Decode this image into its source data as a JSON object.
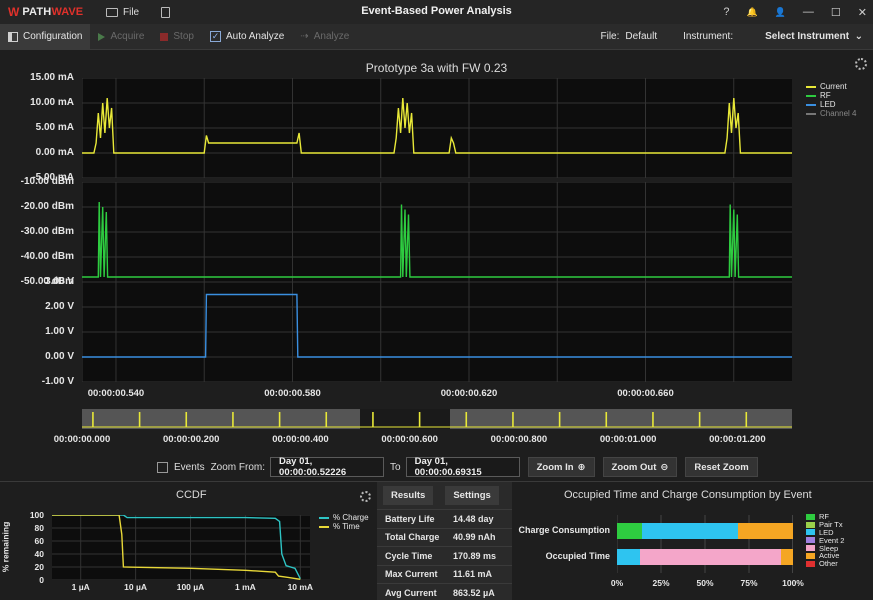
{
  "app": {
    "logo_mark": "W",
    "logo_text_a": "PATH",
    "logo_text_b": "WAVE",
    "title": "Event-Based Power Analysis",
    "file_menu": "File",
    "window_controls": [
      "?",
      "🔔",
      "👤",
      "—",
      "☐",
      "✕"
    ]
  },
  "toolbar": {
    "configuration": "Configuration",
    "acquire": "Acquire",
    "stop": "Stop",
    "auto_analyze": "Auto Analyze",
    "auto_analyze_checked": true,
    "analyze": "Analyze",
    "file_label": "File:",
    "file_value": "Default",
    "instrument_label": "Instrument:",
    "instrument_value": "Select Instrument"
  },
  "main_chart": {
    "title": "Prototype 3a with FW 0.23",
    "legend": [
      {
        "name": "Current",
        "color": "#e8e838"
      },
      {
        "name": "RF",
        "color": "#2ecc40"
      },
      {
        "name": "LED",
        "color": "#3a8fe0"
      },
      {
        "name": "Channel 4",
        "color": "#777777"
      }
    ],
    "current_ticks": [
      "15.00 mA",
      "10.00 mA",
      "5.00 mA",
      "0.00 mA",
      "-5.00 mA"
    ],
    "rf_ticks": [
      "-10.00 dBm",
      "-20.00 dBm",
      "-30.00 dBm",
      "-40.00 dBm",
      "-50.00 dBm"
    ],
    "led_ticks": [
      "3.00 V",
      "2.00 V",
      "1.00 V",
      "0.00 V",
      "-1.00 V"
    ],
    "x_ticks": [
      "00:00:00.540",
      "00:00:00.580",
      "00:00:00.620",
      "00:00:00.660"
    ],
    "overview_ticks": [
      "00:00:00.000",
      "00:00:00.200",
      "00:00:00.400",
      "00:00:00.600",
      "00:00:00.800",
      "00:00:01.000",
      "00:00:01.200"
    ]
  },
  "chart_data": [
    {
      "type": "line",
      "title": "Prototype 3a with FW 0.23",
      "xlabel": "",
      "ylabel": "",
      "x_unit": "s",
      "series": [
        {
          "name": "Current",
          "unit": "mA",
          "ylim": [
            -5,
            15
          ],
          "points": [
            [
              0.5323,
              0
            ],
            [
              0.535,
              0
            ],
            [
              0.5355,
              2
            ],
            [
              0.536,
              8
            ],
            [
              0.5365,
              3
            ],
            [
              0.537,
              10
            ],
            [
              0.5375,
              4
            ],
            [
              0.538,
              11
            ],
            [
              0.5385,
              5
            ],
            [
              0.539,
              9
            ],
            [
              0.5395,
              0
            ],
            [
              0.56,
              0
            ],
            [
              0.5605,
              3.5
            ],
            [
              0.561,
              2
            ],
            [
              0.562,
              2
            ],
            [
              0.57,
              2
            ],
            [
              0.58,
              2
            ],
            [
              0.581,
              2
            ],
            [
              0.5815,
              4
            ],
            [
              0.582,
              0
            ],
            [
              0.603,
              0
            ],
            [
              0.6035,
              3
            ],
            [
              0.604,
              9
            ],
            [
              0.6045,
              4
            ],
            [
              0.605,
              11
            ],
            [
              0.6055,
              5
            ],
            [
              0.606,
              10
            ],
            [
              0.6065,
              4
            ],
            [
              0.607,
              8
            ],
            [
              0.6075,
              0
            ],
            [
              0.6155,
              0
            ],
            [
              0.616,
              3
            ],
            [
              0.6165,
              2
            ],
            [
              0.617,
              0
            ],
            [
              0.678,
              0
            ],
            [
              0.6785,
              3
            ],
            [
              0.679,
              10
            ],
            [
              0.6795,
              4
            ],
            [
              0.68,
              11
            ],
            [
              0.6805,
              5
            ],
            [
              0.681,
              8
            ],
            [
              0.6815,
              0
            ],
            [
              0.6932,
              0
            ]
          ]
        },
        {
          "name": "RF",
          "unit": "dBm",
          "ylim": [
            -50,
            -10
          ],
          "points": [
            [
              0.5323,
              -48
            ],
            [
              0.536,
              -48
            ],
            [
              0.5362,
              -18
            ],
            [
              0.5365,
              -48
            ],
            [
              0.537,
              -20
            ],
            [
              0.5373,
              -48
            ],
            [
              0.5378,
              -22
            ],
            [
              0.5381,
              -48
            ],
            [
              0.6045,
              -48
            ],
            [
              0.6047,
              -19
            ],
            [
              0.605,
              -48
            ],
            [
              0.6055,
              -21
            ],
            [
              0.6058,
              -48
            ],
            [
              0.6063,
              -23
            ],
            [
              0.6066,
              -48
            ],
            [
              0.679,
              -48
            ],
            [
              0.6792,
              -19
            ],
            [
              0.6795,
              -48
            ],
            [
              0.68,
              -21
            ],
            [
              0.6803,
              -48
            ],
            [
              0.6808,
              -23
            ],
            [
              0.6811,
              -48
            ],
            [
              0.6932,
              -48
            ]
          ]
        },
        {
          "name": "LED",
          "unit": "V",
          "ylim": [
            -1,
            3
          ],
          "points": [
            [
              0.5323,
              0
            ],
            [
              0.5603,
              0
            ],
            [
              0.5605,
              2.5
            ],
            [
              0.581,
              2.5
            ],
            [
              0.5812,
              0
            ],
            [
              0.6932,
              0
            ]
          ]
        }
      ]
    },
    {
      "type": "line",
      "title": "CCDF",
      "xlabel": "",
      "ylabel": "% remaining",
      "x_scale": "log",
      "x_ticks": [
        "1 µA",
        "10 µA",
        "100 µA",
        "1 mA",
        "10 mA"
      ],
      "y_ticks": [
        "100",
        "80",
        "60",
        "40",
        "20",
        "0"
      ],
      "ylim": [
        0,
        100
      ],
      "series": [
        {
          "name": "% Charge",
          "color": "#2ec4c4",
          "points": [
            [
              0.3,
              100
            ],
            [
              6,
              100
            ],
            [
              7,
              96
            ],
            [
              100,
              96
            ],
            [
              1000,
              96
            ],
            [
              3500,
              95
            ],
            [
              4200,
              90
            ],
            [
              4600,
              40
            ],
            [
              5500,
              22
            ],
            [
              8000,
              18
            ],
            [
              10000,
              2
            ]
          ]
        },
        {
          "name": "% Time",
          "color": "#e8d838",
          "points": [
            [
              0.3,
              100
            ],
            [
              5,
              100
            ],
            [
              5.6,
              70
            ],
            [
              6,
              20
            ],
            [
              20,
              19
            ],
            [
              100,
              18
            ],
            [
              1000,
              15
            ],
            [
              3500,
              12
            ],
            [
              4000,
              6
            ],
            [
              6000,
              4
            ],
            [
              10000,
              1
            ]
          ]
        }
      ]
    },
    {
      "type": "bar",
      "title": "Occupied Time and Charge Consumption by Event",
      "orientation": "horizontal",
      "stacked": true,
      "categories": [
        "Charge Consumption",
        "Occupied Time"
      ],
      "x_ticks": [
        "0%",
        "25%",
        "50%",
        "75%",
        "100%"
      ],
      "series": [
        {
          "name": "RF",
          "color": "#2ecc40",
          "values": [
            14,
            0
          ]
        },
        {
          "name": "LED",
          "color": "#2ec4f0",
          "values": [
            55,
            13
          ]
        },
        {
          "name": "Sleep",
          "color": "#f4a6c9",
          "values": [
            0,
            80
          ]
        },
        {
          "name": "Active",
          "color": "#f5a623",
          "values": [
            31,
            7
          ]
        }
      ],
      "legend": [
        {
          "name": "RF",
          "color": "#2ecc40"
        },
        {
          "name": "Pair Tx",
          "color": "#9bd04a"
        },
        {
          "name": "LED",
          "color": "#2ec4f0"
        },
        {
          "name": "Event 2",
          "color": "#a080e0"
        },
        {
          "name": "Sleep",
          "color": "#f4a6c9"
        },
        {
          "name": "Active",
          "color": "#f5a623"
        },
        {
          "name": "Other",
          "color": "#e03030"
        }
      ]
    }
  ],
  "zoom": {
    "events_label": "Events",
    "zoom_from_label": "Zoom From:",
    "zoom_from": "Day 01, 00:00:00.52226",
    "to_label": "To",
    "zoom_to": "Day 01, 00:00:00.69315",
    "zoom_in": "Zoom In",
    "zoom_out": "Zoom Out",
    "reset_zoom": "Reset Zoom"
  },
  "ccdf": {
    "title": "CCDF",
    "legend": [
      {
        "name": "% Charge",
        "color": "#2ec4c4"
      },
      {
        "name": "% Time",
        "color": "#e8d838"
      }
    ]
  },
  "results": {
    "tab_results": "Results",
    "tab_settings": "Settings",
    "rows": [
      {
        "k": "Battery Life",
        "v": "14.48 day"
      },
      {
        "k": "Total Charge",
        "v": "40.99 nAh"
      },
      {
        "k": "Cycle Time",
        "v": "170.89 ms"
      },
      {
        "k": "Max Current",
        "v": "11.61 mA"
      },
      {
        "k": "Avg Current",
        "v": "863.52 µA"
      }
    ]
  },
  "occupied": {
    "title": "Occupied Time and Charge Consumption by Event"
  }
}
